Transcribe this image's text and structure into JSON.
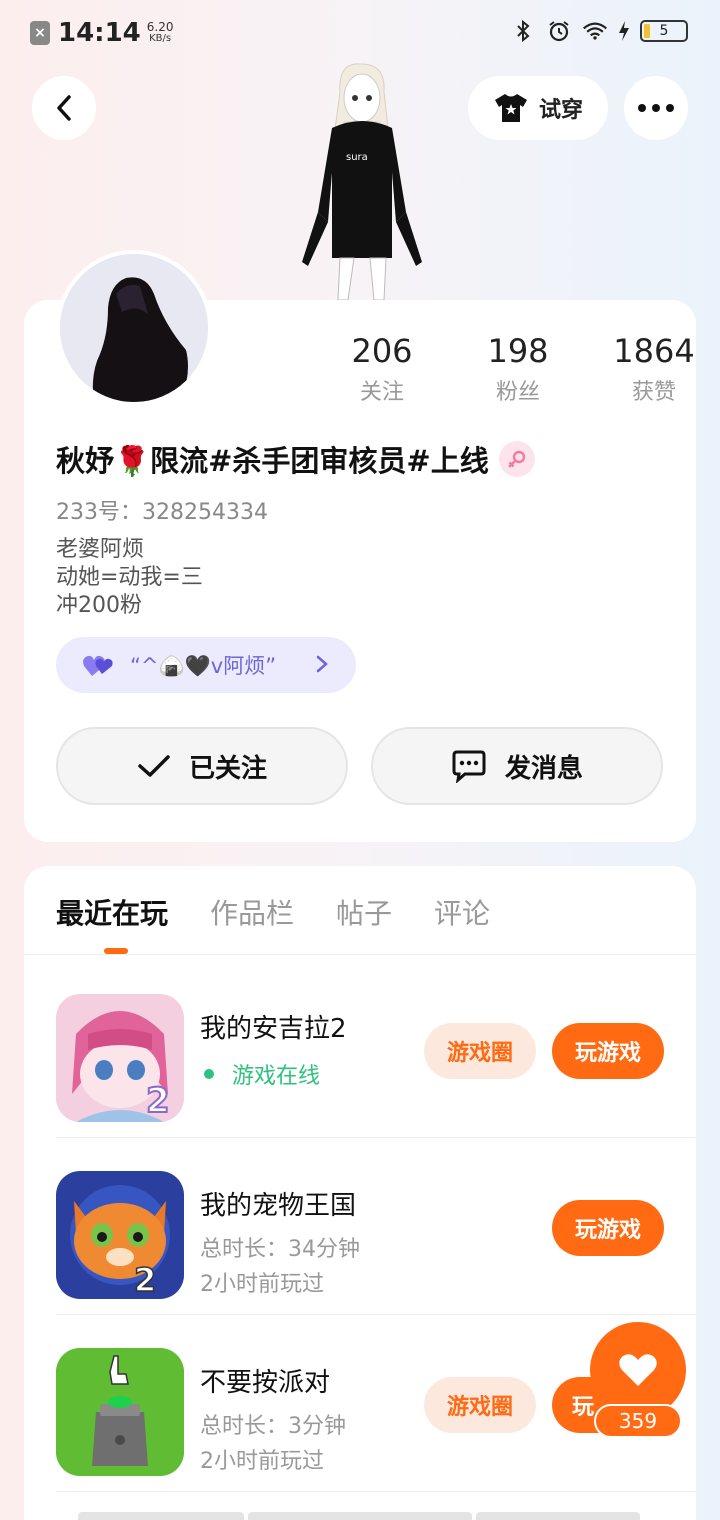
{
  "status_bar": {
    "time": "14:14",
    "speed_value": "6.20",
    "speed_unit": "KB/s",
    "battery": "5"
  },
  "header": {
    "tryon_label": "试穿"
  },
  "profile": {
    "stats": [
      {
        "value": "206",
        "label": "关注"
      },
      {
        "value": "198",
        "label": "粉丝"
      },
      {
        "value": "1864",
        "label": "获赞"
      }
    ],
    "nickname": "秋妤🌹限流#杀手团审核员#上线",
    "uid": "233号：328254334",
    "bio": [
      "老婆阿烦",
      "动她=动我=三",
      "冲200粉"
    ],
    "cp_name": "“^🍙🖤v阿烦”",
    "follow_label": "已关注",
    "message_label": "发消息"
  },
  "tabs": [
    "最近在玩",
    "作品栏",
    "帖子",
    "评论"
  ],
  "games": [
    {
      "name": "我的安吉拉2",
      "status": "游戏在线",
      "circle_label": "游戏圈",
      "play_label": "玩游戏"
    },
    {
      "name": "我的宠物王国",
      "duration": "总时长：34分钟",
      "last_played": "2小时前玩过",
      "play_label": "玩游戏"
    },
    {
      "name": "不要按派对",
      "duration": "总时长：3分钟",
      "last_played": "2小时前玩过",
      "circle_label": "游戏圈",
      "play_label": "玩"
    }
  ],
  "like_count": "359",
  "colors": {
    "accent": "#ff6a13",
    "online": "#2ec27e",
    "cp": "#6d66d8"
  }
}
